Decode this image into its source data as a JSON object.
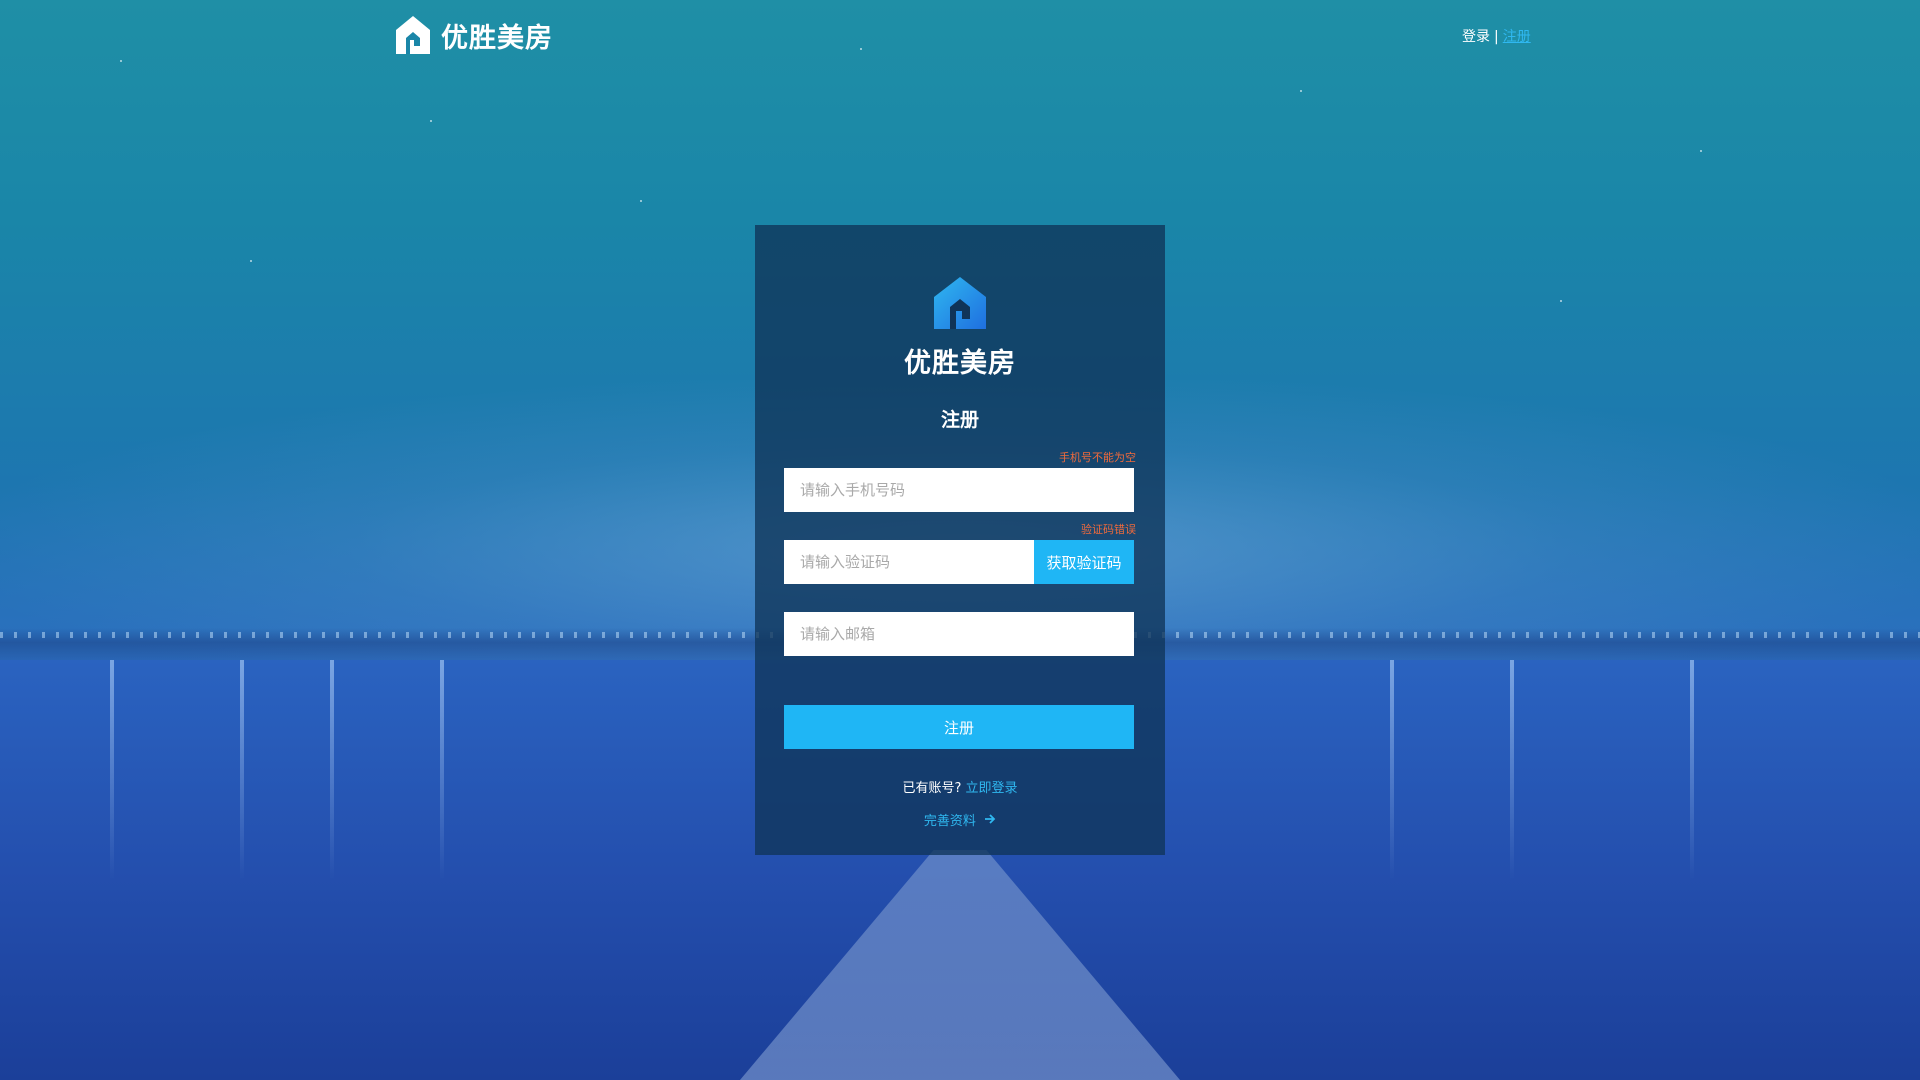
{
  "header": {
    "brand": "优胜美房",
    "login_label": "登录",
    "separator": "|",
    "register_label": "注册"
  },
  "card": {
    "brand": "优胜美房",
    "title": "注册",
    "phone": {
      "error": "手机号不能为空",
      "placeholder": "请输入手机号码"
    },
    "code": {
      "error": "验证码错误",
      "placeholder": "请输入验证码",
      "button_label": "获取验证码"
    },
    "email": {
      "placeholder": "请输入邮箱"
    },
    "submit_label": "注册",
    "have_account_text": "已有账号?",
    "login_now_label": "立即登录",
    "complete_profile_label": "完善资料"
  },
  "icons": {
    "brand_logo": "house-logo-icon",
    "arrow": "arrow-right-icon"
  },
  "colors": {
    "accent": "#1fb6f5",
    "link": "#2fb8f0",
    "error": "#f06a3c",
    "card_bg": "#103458"
  }
}
